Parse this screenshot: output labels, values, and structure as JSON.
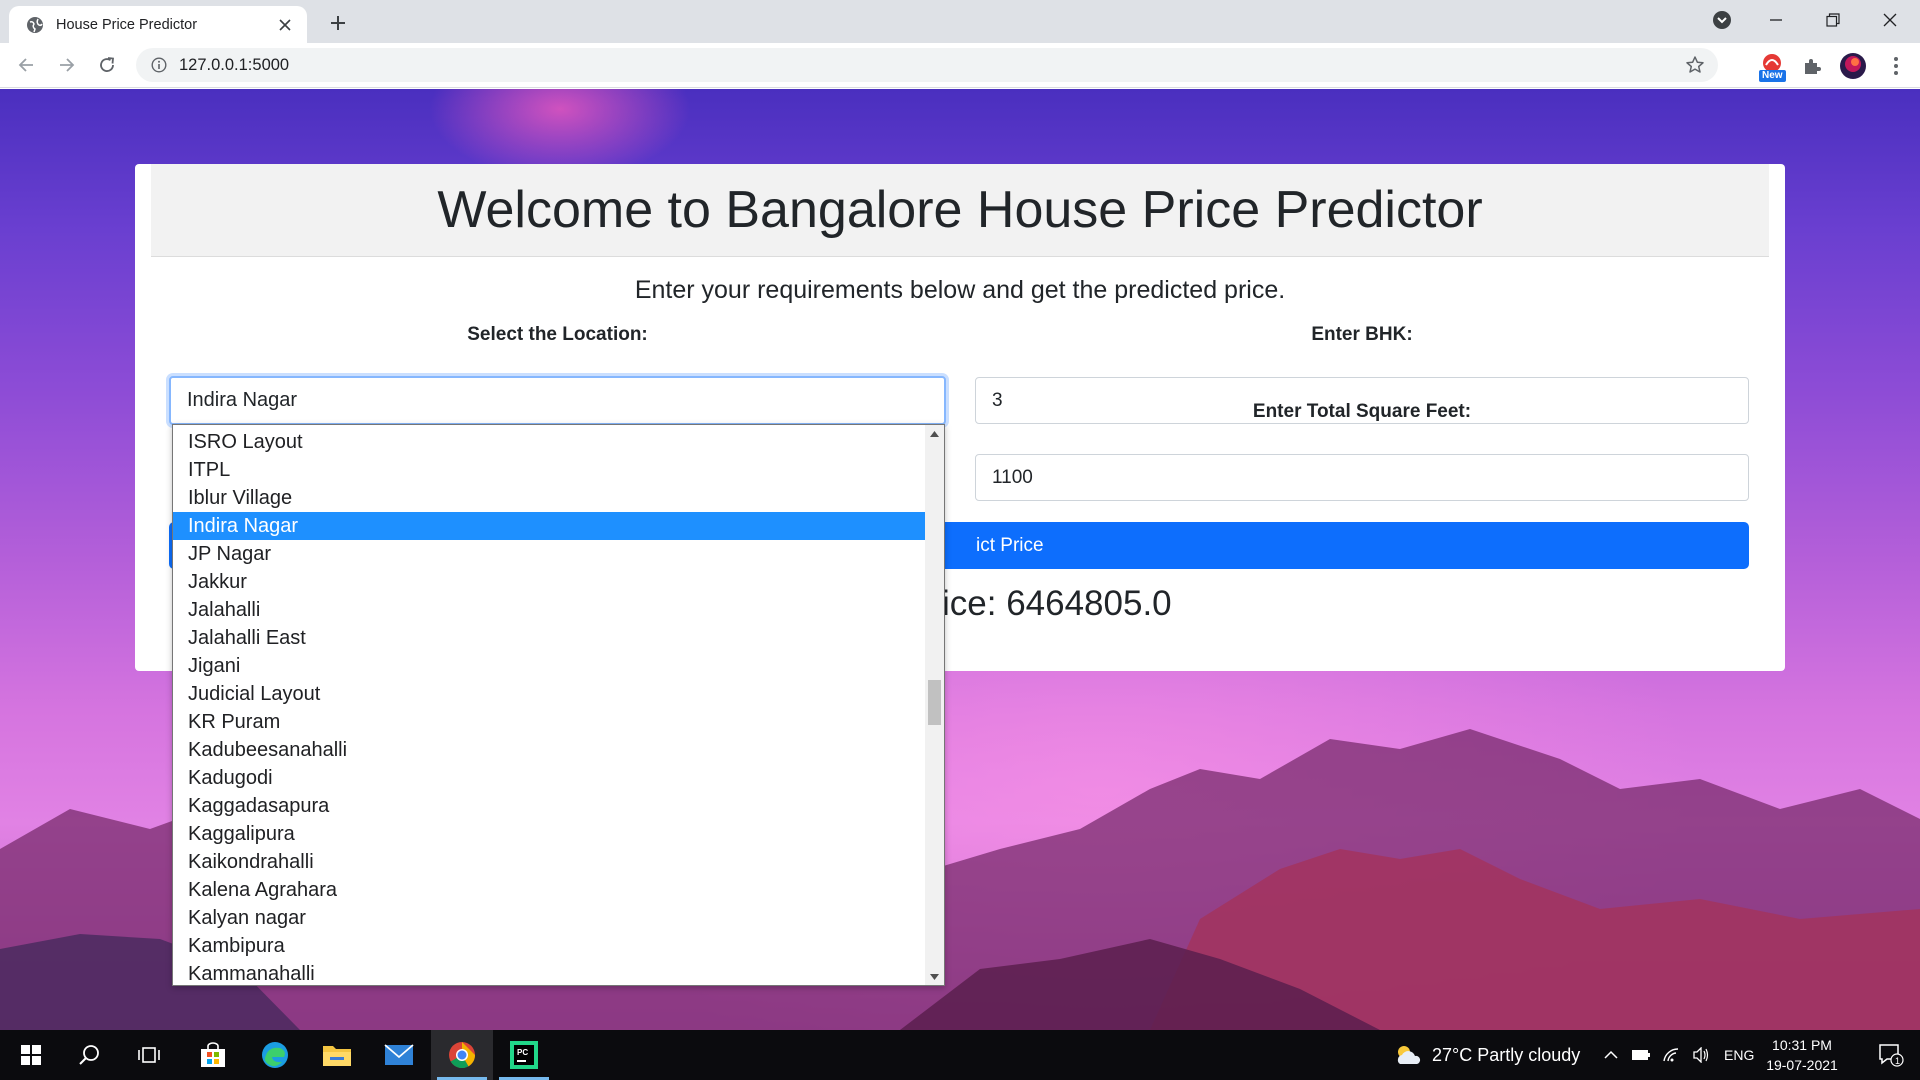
{
  "browser": {
    "tab_title": "House Price Predictor",
    "url": "127.0.0.1:5000",
    "extension_badge": "New"
  },
  "page": {
    "title": "Welcome to Bangalore House Price Predictor",
    "subtitle": "Enter your requirements below and get the predicted price.",
    "location_label": "Select the Location:",
    "location_value": "Indira Nagar",
    "bhk_label": "Enter BHK:",
    "bhk_value": "3",
    "sqft_label": "Enter Total Square Feet:",
    "sqft_value": "1100",
    "predict_button_visible": "ict Price",
    "prediction_visible": "ice: 6464805.0"
  },
  "dropdown": {
    "selected": "Indira Nagar",
    "items": [
      "ISRO Layout",
      "ITPL",
      "Iblur Village",
      "Indira Nagar",
      "JP Nagar",
      "Jakkur",
      "Jalahalli",
      "Jalahalli East",
      "Jigani",
      "Judicial Layout",
      "KR Puram",
      "Kadubeesanahalli",
      "Kadugodi",
      "Kaggadasapura",
      "Kaggalipura",
      "Kaikondrahalli",
      "Kalena Agrahara",
      "Kalyan nagar",
      "Kambipura",
      "Kammanahalli"
    ]
  },
  "taskbar": {
    "weather": "27°C  Partly cloudy",
    "language": "ENG",
    "time": "10:31 PM",
    "date": "19-07-2021",
    "notification_count": "1"
  },
  "colors": {
    "primary": "#0d6efd",
    "selected_option": "#1e90ff",
    "focus_ring": "#86b7fe"
  }
}
